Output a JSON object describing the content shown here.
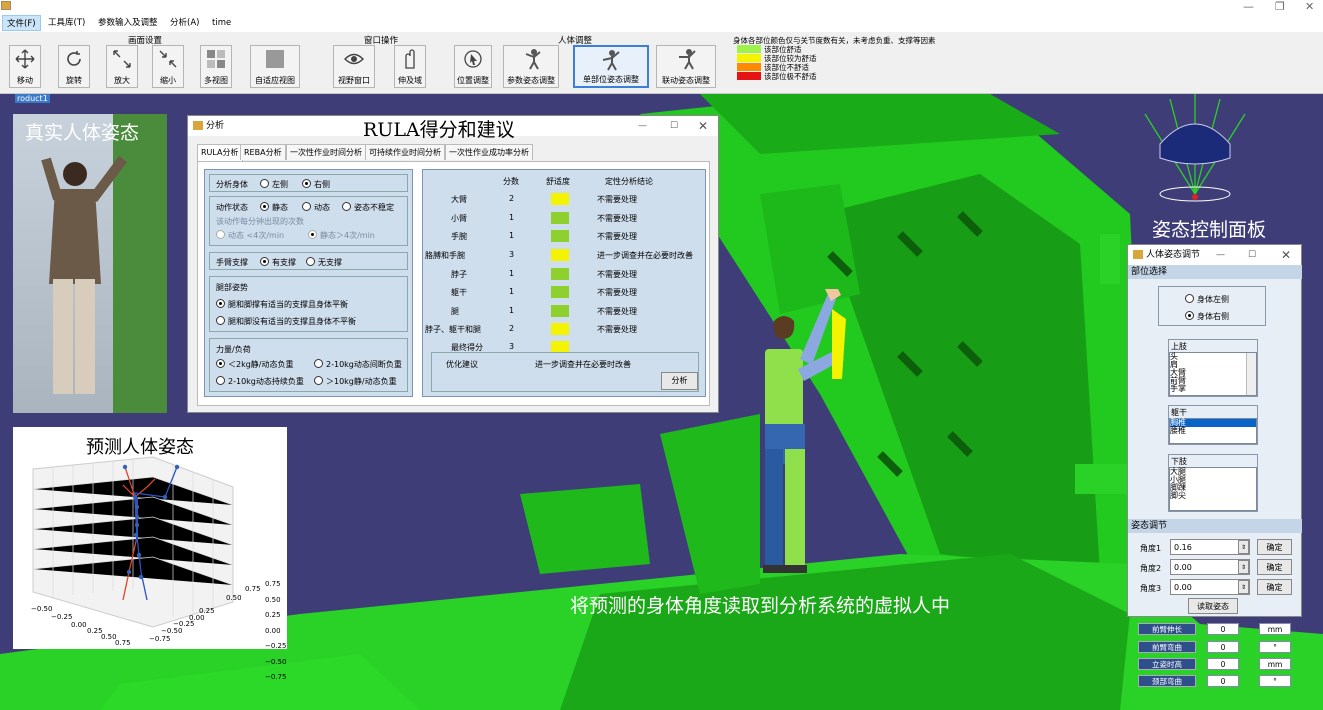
{
  "menu": {
    "file": "文件(F)",
    "tools": "工具库(T)",
    "params": "参数输入及调整",
    "analysis": "分析(A)",
    "time": "time"
  },
  "toolbar": {
    "group_view": "画面设置",
    "group_window": "窗口操作",
    "group_human": "人体调整",
    "move": "移动",
    "rotate": "旋转",
    "zoom_in": "放大",
    "zoom_out": "缩小",
    "multi_view": "多视图",
    "fit_view": "自适应视图",
    "view_window": "视野窗口",
    "reach": "伸及域",
    "position": "位置调整",
    "param_pose": "参数姿态调整",
    "single_pose": "单部位姿态调整",
    "link_pose": "联动姿态调整"
  },
  "legend": {
    "title": "身体各部位颜色仅与关节度数有关，未考虑负重、支撑等因素",
    "items": [
      {
        "label": "该部位舒适",
        "color": "#9ff24a"
      },
      {
        "label": "该部位较为舒适",
        "color": "#f4f400"
      },
      {
        "label": "该部位不舒适",
        "color": "#ff8a00"
      },
      {
        "label": "该部位极不舒适",
        "color": "#e51313"
      }
    ]
  },
  "viewport": {
    "product_tag": "roduct1",
    "real_pose_caption": "真实人体姿态",
    "rula_caption": "RULA得分和建议",
    "predicted_caption": "预测人体姿态",
    "control_caption": "姿态控制面板",
    "bottom_caption": "将预测的身体角度读取到分析系统的虚拟人中"
  },
  "analysis_window": {
    "title": "分析",
    "tabs": [
      "RULA分析",
      "REBA分析",
      "一次性作业时间分析",
      "可持续作业时间分析",
      "一次性作业成功率分析"
    ],
    "body_side": {
      "label": "分析身体",
      "left": "左侧",
      "right": "右侧"
    },
    "motion": {
      "label": "动作状态",
      "static": "静态",
      "dynamic": "动态",
      "unstable": "姿态不稳定",
      "freq_label": "该动作每分钟出现的次数",
      "freq_low": "动态 <4次/min",
      "freq_high": "静态＞4次/min"
    },
    "arm_support": {
      "label": "手臂支撑",
      "yes": "有支撑",
      "no": "无支撑"
    },
    "leg": {
      "label": "腿部姿势",
      "opt1": "腿和脚撑有适当的支撑且身体平衡",
      "opt2": "腿和脚没有适当的支撑且身体不平衡"
    },
    "load": {
      "label": "力量/负荷",
      "opt1": "＜2kg静/动态负重",
      "opt2": "2-10kg动态间断负重",
      "opt3": "2-10kg动态持续负重",
      "opt4": "＞10kg静/动态负重"
    },
    "table_headers": {
      "score": "分数",
      "comfort": "舒适度",
      "conclusion": "定性分析结论"
    },
    "rows": [
      {
        "part": "大臂",
        "score": "2",
        "color": "#f4f400",
        "conclusion": "不需要处理"
      },
      {
        "part": "小臂",
        "score": "1",
        "color": "#8ed12e",
        "conclusion": "不需要处理"
      },
      {
        "part": "手腕",
        "score": "1",
        "color": "#8ed12e",
        "conclusion": "不需要处理"
      },
      {
        "part": "胳膊和手腕",
        "score": "3",
        "color": "#f4f400",
        "conclusion": "进一步调查并在必要时改善"
      },
      {
        "part": "脖子",
        "score": "1",
        "color": "#8ed12e",
        "conclusion": "不需要处理"
      },
      {
        "part": "躯干",
        "score": "1",
        "color": "#8ed12e",
        "conclusion": "不需要处理"
      },
      {
        "part": "腿",
        "score": "1",
        "color": "#8ed12e",
        "conclusion": "不需要处理"
      },
      {
        "part": "脖子、躯干和腿",
        "score": "2",
        "color": "#f4f400",
        "conclusion": "不需要处理"
      },
      {
        "part": "最终得分",
        "score": "3",
        "color": "#f4f400",
        "conclusion": ""
      }
    ],
    "advice_label": "优化建议",
    "advice_text": "进一步调查并在必要时改善",
    "analyze_btn": "分析"
  },
  "plot": {
    "z_ticks": [
      "0.75",
      "0.50",
      "0.25",
      "0.00",
      "−0.25",
      "−0.50",
      "−0.75"
    ],
    "x_ticks": [
      "−0.50",
      "−0.25",
      "0.00",
      "0.25",
      "0.50",
      "0.75"
    ],
    "y_ticks": [
      "−0.75",
      "−0.50",
      "−0.25",
      "0.00",
      "0.25",
      "0.50",
      "0.75"
    ]
  },
  "pose_window": {
    "title": "人体姿态调节",
    "section_part": "部位选择",
    "left": "身体左侧",
    "right": "身体右侧",
    "upper_label": "上肢",
    "upper_items": [
      "头",
      "肩",
      "大臂",
      "前臂",
      "手掌"
    ],
    "trunk_label": "躯干",
    "trunk_items": [
      "胸椎",
      "腰椎"
    ],
    "lower_label": "下肢",
    "lower_items": [
      "大腿",
      "小腿",
      "脚踝",
      "脚尖"
    ],
    "section_adjust": "姿态调节",
    "angles": [
      {
        "label": "角度1",
        "value": "0.16"
      },
      {
        "label": "角度2",
        "value": "0.00"
      },
      {
        "label": "角度3",
        "value": "0.00"
      }
    ],
    "confirm": "确定",
    "read_pose": "读取姿态"
  },
  "bottom_params": [
    {
      "label": "前臂伸长",
      "value": "0",
      "unit": "mm"
    },
    {
      "label": "前臂弯曲",
      "value": "0",
      "unit": "°"
    },
    {
      "label": "立姿时高",
      "value": "0",
      "unit": "mm"
    },
    {
      "label": "颈部弯曲",
      "value": "0",
      "unit": "°"
    }
  ]
}
